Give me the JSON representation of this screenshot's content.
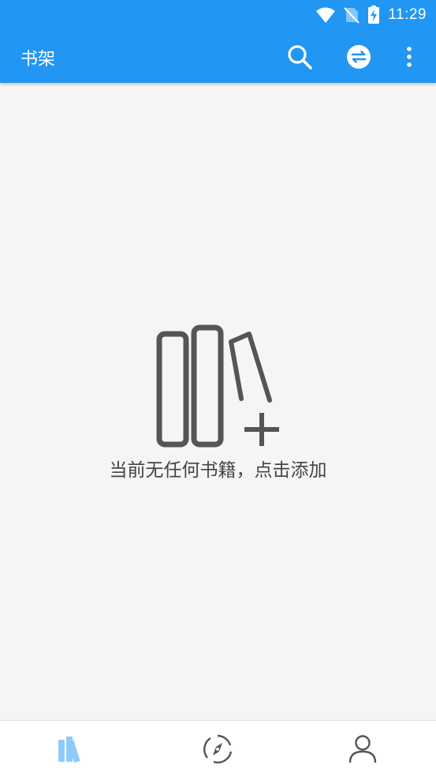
{
  "status_bar": {
    "time": "11:29",
    "icons": [
      "wifi-icon",
      "no-sim-icon",
      "battery-charging-icon"
    ]
  },
  "app_bar": {
    "title": "书架",
    "actions": [
      "search-icon",
      "sync-icon",
      "more-vert-icon"
    ]
  },
  "empty_state": {
    "illustration": "add-books-icon",
    "message": "当前无任何书籍，点击添加"
  },
  "bottom_nav": {
    "items": [
      {
        "icon": "bookshelf-icon",
        "selected": true
      },
      {
        "icon": "compass-icon",
        "selected": false
      },
      {
        "icon": "person-icon",
        "selected": false
      }
    ]
  },
  "colors": {
    "primary": "#2196f3",
    "background": "#f5f5f5",
    "selected_nav": "#90caf9",
    "icon_gray": "#555555"
  }
}
